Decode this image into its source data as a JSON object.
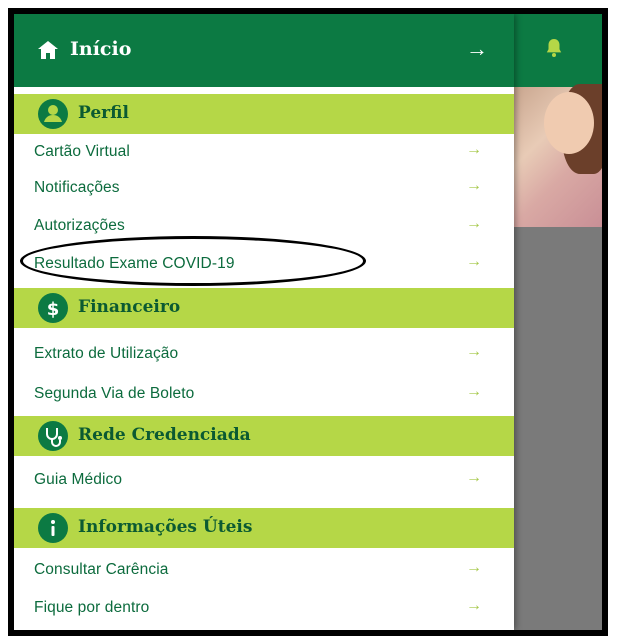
{
  "home": {
    "label": "Início",
    "arrow": "→"
  },
  "sections": [
    {
      "title": "Perfil",
      "icon": "user-icon",
      "items": [
        {
          "label": "Cartão Virtual",
          "arrow": "→"
        },
        {
          "label": "Notificações",
          "arrow": "→"
        },
        {
          "label": "Autorizações",
          "arrow": "→"
        },
        {
          "label": "Resultado Exame COVID-19",
          "arrow": "→"
        }
      ]
    },
    {
      "title": "Financeiro",
      "icon": "dollar-icon",
      "items": [
        {
          "label": "Extrato de Utilização",
          "arrow": "→"
        },
        {
          "label": "Segunda Via de Boleto",
          "arrow": "→"
        }
      ]
    },
    {
      "title": "Rede Credenciada",
      "icon": "stethoscope-icon",
      "items": [
        {
          "label": "Guia Médico",
          "arrow": "→"
        }
      ]
    },
    {
      "title": "Informações Úteis",
      "icon": "info-icon",
      "items": [
        {
          "label": "Consultar Carência",
          "arrow": "→"
        },
        {
          "label": "Fique por dentro",
          "arrow": "→"
        }
      ]
    }
  ],
  "icons": {
    "home": "home-icon",
    "notifications": "bell-icon"
  },
  "colors": {
    "primary": "#0c7a43",
    "section_bg": "#b5d747",
    "text": "#0c6b3d",
    "arrow": "#a6c94b"
  }
}
